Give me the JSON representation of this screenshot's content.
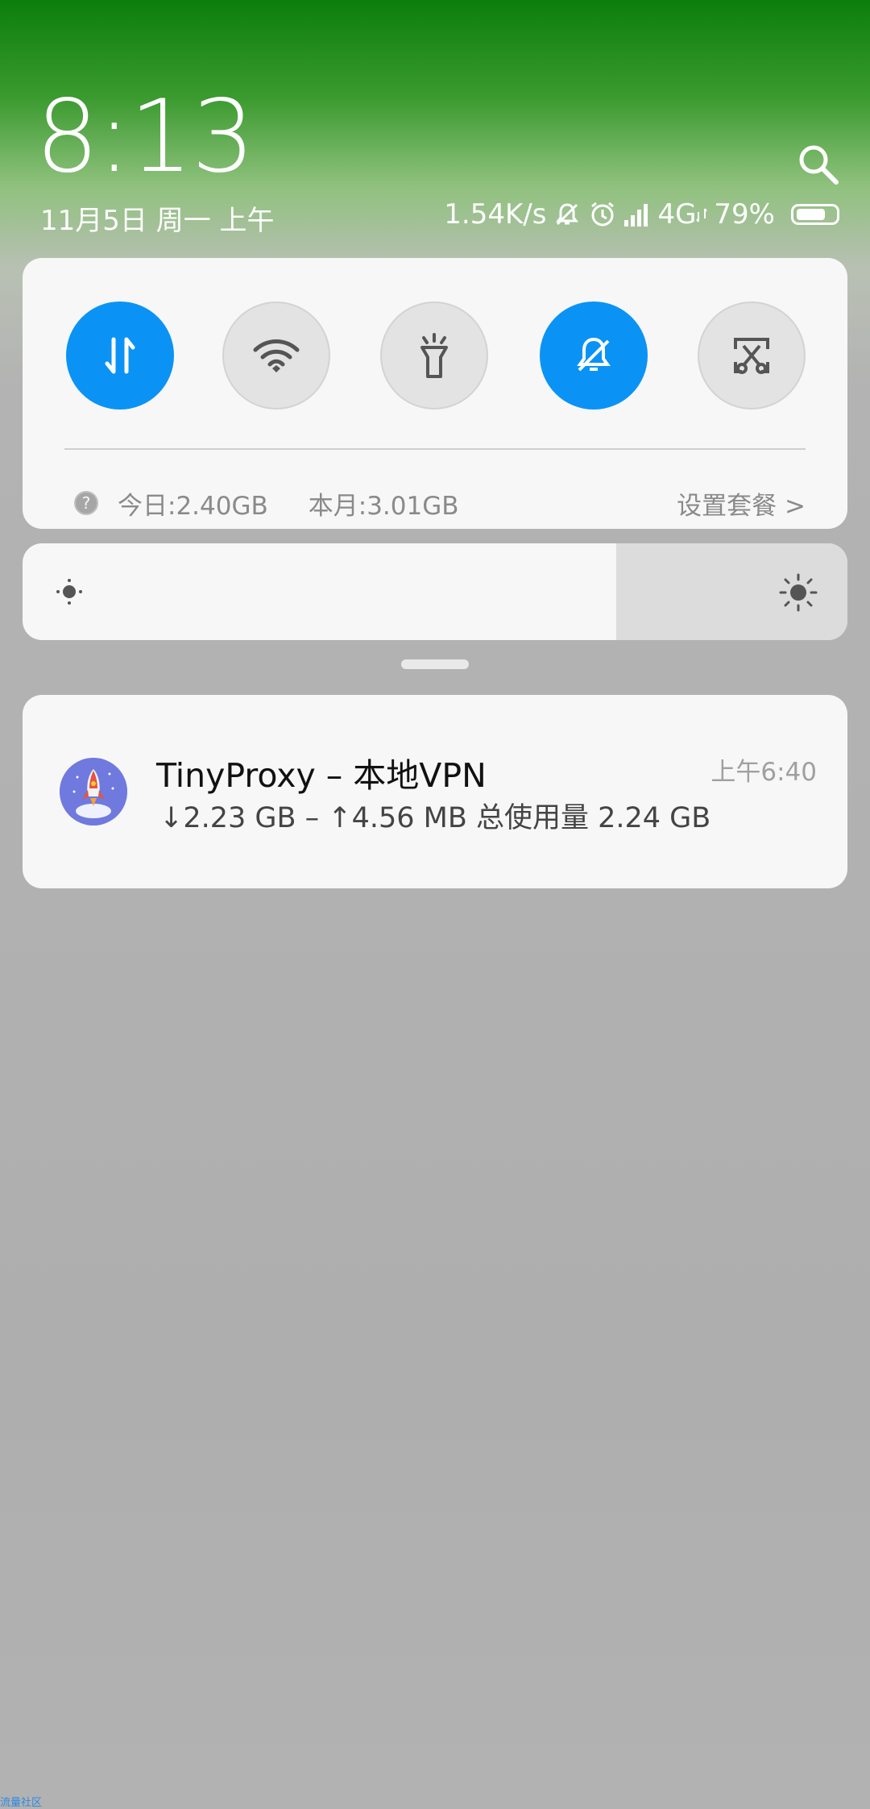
{
  "header": {
    "time": "8:13",
    "date": "11月5日 周一 上午",
    "search_icon": "search-icon"
  },
  "status": {
    "net_speed": "1.54K/s",
    "network": "4G",
    "battery": "79%",
    "battery_level": 0.79,
    "icons": [
      "mute-bell-icon",
      "alarm-clock-icon",
      "signal-bars-icon",
      "data-arrows-icon",
      "battery-icon"
    ]
  },
  "quick_settings": {
    "toggles": [
      {
        "name": "mobile-data",
        "icon": "data-arrows-icon",
        "state": "on"
      },
      {
        "name": "wifi",
        "icon": "wifi-icon",
        "state": "off"
      },
      {
        "name": "flashlight",
        "icon": "flashlight-icon",
        "state": "off"
      },
      {
        "name": "silent",
        "icon": "mute-bell-icon",
        "state": "on"
      },
      {
        "name": "screenshot",
        "icon": "scissors-screenshot-icon",
        "state": "off"
      }
    ],
    "data_today": "今日:2.40GB",
    "data_month": "本月:3.01GB",
    "plan_link": "设置套餐 >",
    "help_glyph": "?"
  },
  "brightness": {
    "level": 0.72
  },
  "notification": {
    "app": "TinyProxy",
    "title": "TinyProxy – 本地VPN",
    "time": "上午6:40",
    "body": "↓2.23 GB – ↑4.56 MB 总使用量 2.24 GB",
    "icon": "rocket-icon"
  },
  "watermark": "流量社区",
  "colors": {
    "accent": "#0a93f5",
    "card": "#f7f7f7",
    "toggle_off": "#e3e3e3"
  }
}
